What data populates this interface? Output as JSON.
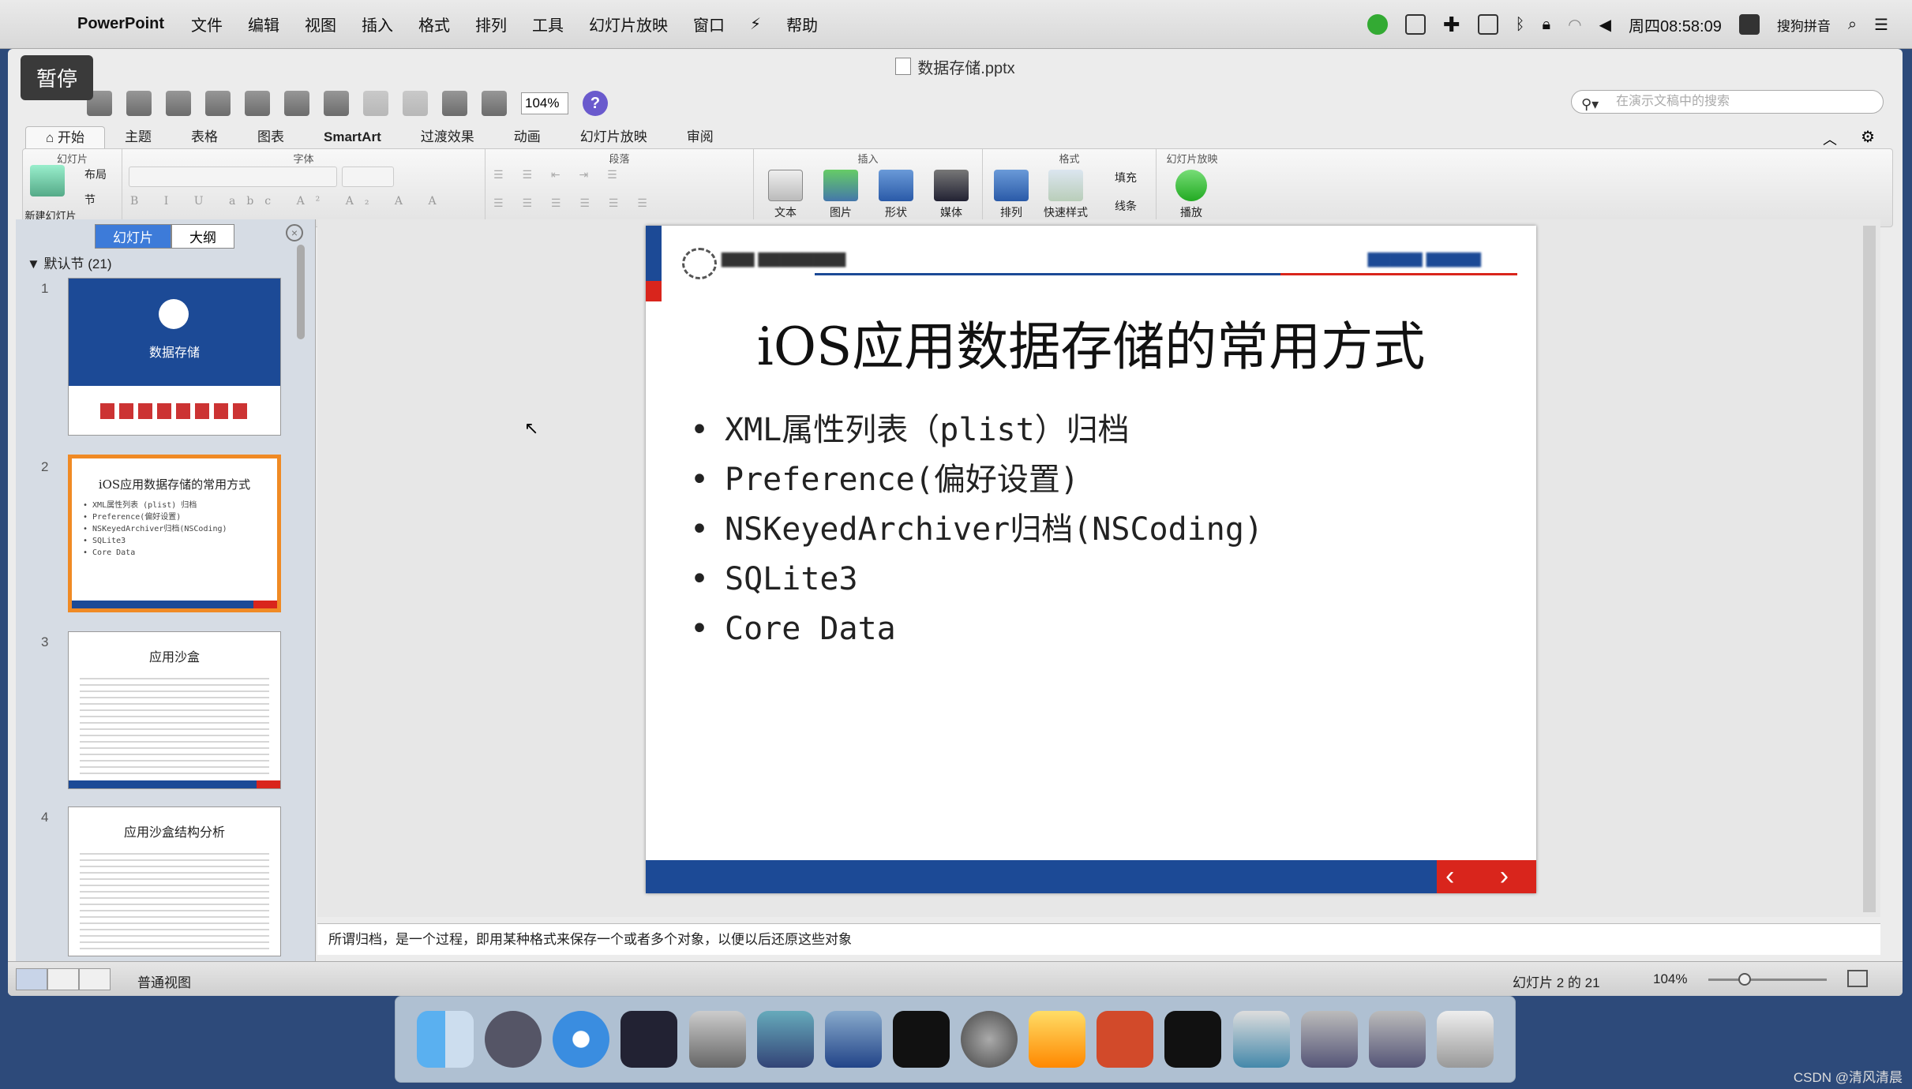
{
  "menubar": {
    "app_name": "PowerPoint",
    "items": [
      "文件",
      "编辑",
      "视图",
      "插入",
      "格式",
      "排列",
      "工具",
      "幻灯片放映",
      "窗口",
      "帮助"
    ],
    "clock": "周四08:58:09",
    "ime": "搜狗拼音"
  },
  "window": {
    "title": "数据存储.pptx",
    "pause_label": "暂停",
    "zoom": "104%",
    "search_placeholder": "在演示文稿中的搜索"
  },
  "ribbon_tabs": [
    "开始",
    "主题",
    "表格",
    "图表",
    "SmartArt",
    "过渡效果",
    "动画",
    "幻灯片放映",
    "审阅"
  ],
  "ribbon": {
    "groups": {
      "slides": "幻灯片",
      "font": "字体",
      "paragraph": "段落",
      "insert": "插入",
      "format": "格式",
      "slideshow": "幻灯片放映"
    },
    "new_slide": "新建幻灯片",
    "layout": "布局",
    "section": "节",
    "text": "文本",
    "picture": "图片",
    "shape": "形状",
    "media": "媒体",
    "arrange": "排列",
    "quick_styles": "快速样式",
    "fill": "填充",
    "line": "线条",
    "play": "播放"
  },
  "left_pane": {
    "tab_slides": "幻灯片",
    "tab_outline": "大纲",
    "section": "▼ 默认节 (21)",
    "slides": [
      {
        "num": "1",
        "title": "数据存储"
      },
      {
        "num": "2",
        "title": "iOS应用数据存储的常用方式",
        "lines": [
          "• XML属性列表 (plist) 归档",
          "• Preference(偏好设置)",
          "• NSKeyedArchiver归档(NSCoding)",
          "• SQLite3",
          "• Core Data"
        ]
      },
      {
        "num": "3",
        "title": "应用沙盒"
      },
      {
        "num": "4",
        "title": "应用沙盒结构分析"
      }
    ]
  },
  "slide": {
    "title": "iOS应用数据存储的常用方式",
    "bullets": [
      "XML属性列表（plist）归档",
      "Preference(偏好设置)",
      "NSKeyedArchiver归档(NSCoding)",
      "SQLite3",
      "Core Data"
    ],
    "nav": "‹ ›"
  },
  "notes": "所谓归档，是一个过程，即用某种格式来保存一个或者多个对象，以便以后还原这些对象",
  "status": {
    "view": "普通视图",
    "slide_counter": "幻灯片 2 的 21",
    "zoom": "104%"
  },
  "watermark": "CSDN @清风清晨",
  "colors": {
    "accent_blue": "#1c4a96",
    "accent_red": "#d9251c",
    "selection": "#f08a24"
  }
}
